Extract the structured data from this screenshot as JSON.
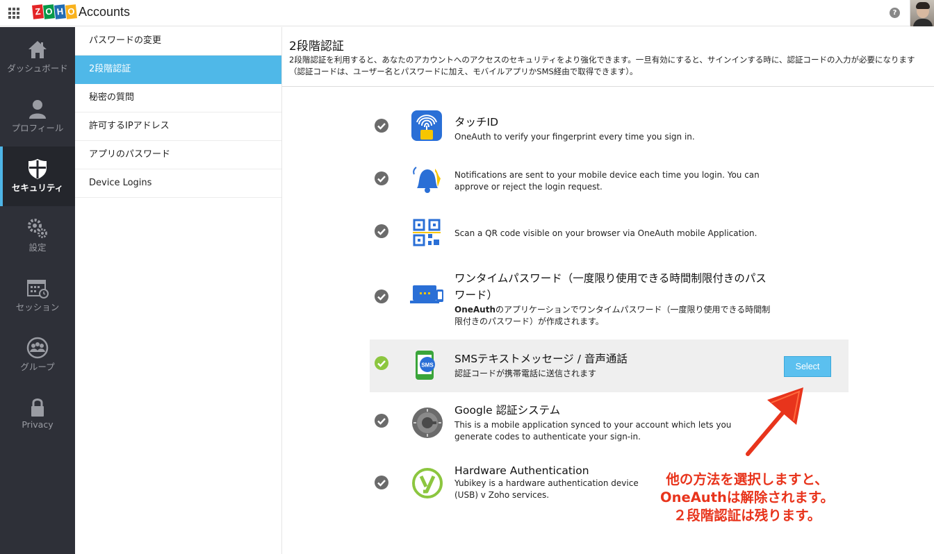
{
  "header": {
    "app_title": "Accounts",
    "logo_letters": [
      "Z",
      "O",
      "H",
      "O"
    ],
    "logo_colors": [
      "#e42527",
      "#089949",
      "#226db4",
      "#f9b21d"
    ],
    "help": "?"
  },
  "sidebar": {
    "items": [
      {
        "label": "ダッシュボード",
        "icon": "home-icon"
      },
      {
        "label": "プロフィール",
        "icon": "user-icon"
      },
      {
        "label": "セキュリティ",
        "icon": "shield-icon",
        "active": true
      },
      {
        "label": "設定",
        "icon": "gears-icon"
      },
      {
        "label": "セッション",
        "icon": "calendar-clock-icon"
      },
      {
        "label": "グループ",
        "icon": "group-icon"
      },
      {
        "label": "Privacy",
        "icon": "lock-icon"
      }
    ]
  },
  "submenu": {
    "items": [
      {
        "label": "パスワードの変更"
      },
      {
        "label": "2段階認証",
        "active": true
      },
      {
        "label": "秘密の質問"
      },
      {
        "label": "許可するIPアドレス"
      },
      {
        "label": "アプリのパスワード"
      },
      {
        "label": "Device Logins"
      }
    ]
  },
  "main": {
    "title": "2段階認証",
    "description": "2段階認証を利用すると、あなたのアカウントへのアクセスのセキュリティをより強化できます。一旦有効にすると、サインインする時に、認証コードの入力が必要になります（認証コードは、ユーザー名とパスワードに加え、モバイルアプリかSMS経由で取得できます）。",
    "methods": [
      {
        "title": "タッチID",
        "desc": "OneAuth to verify your fingerprint every time you sign in.",
        "icon": "fingerprint-icon"
      },
      {
        "title": "",
        "desc": "Notifications are sent to your mobile device each time you login. You can approve or reject the login request.",
        "icon": "bell-icon"
      },
      {
        "title": "",
        "desc": "Scan a QR code visible on your browser via OneAuth mobile Application.",
        "icon": "qr-code-icon"
      },
      {
        "title": "ワンタイムパスワード（一度限り使用できる時間制限付きのパスワード）",
        "desc_bold": "OneAuth",
        "desc": "のアプリケーションでワンタイムパスワード（一度限り使用できる時間制限付きのパスワード）が作成されます。",
        "icon": "laptop-phone-icon"
      },
      {
        "title": "SMSテキストメッセージ / 音声通話",
        "desc": "認証コードが携帯電話に送信されます",
        "icon": "sms-phone-icon",
        "selected": true,
        "button": "Select"
      },
      {
        "title": "Google 認証システム",
        "desc": "This is a mobile application synced to your account which lets you generate codes to authenticate your sign-in.",
        "icon": "google-authenticator-icon"
      },
      {
        "title": "Hardware Authentication",
        "desc": "Yubikey is a hardware authentication device (USB) v Zoho services.",
        "icon": "yubikey-icon"
      }
    ]
  },
  "annotation": {
    "lines": [
      "他の方法を選択しますと、",
      "OneAuthは解除されます。",
      "２段階認証は残ります。"
    ],
    "color": "#e8341c"
  }
}
